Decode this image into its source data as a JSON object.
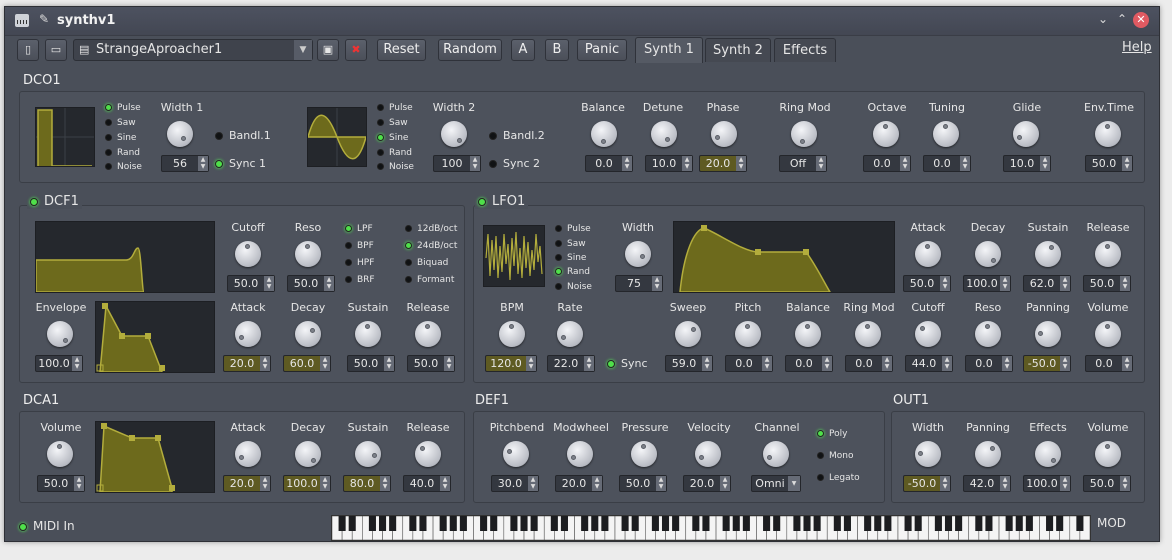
{
  "window": {
    "title": "synthv1",
    "minimize": "⌄",
    "maximize": "⌃",
    "close": "✕"
  },
  "toolbar": {
    "preset": "StrangeAproacher1",
    "reset": "Reset",
    "random": "Random",
    "a": "A",
    "b": "B",
    "panic": "Panic",
    "help": "Help"
  },
  "tabs": [
    {
      "label": "Synth 1",
      "active": true
    },
    {
      "label": "Synth 2",
      "active": false
    },
    {
      "label": "Effects",
      "active": false
    }
  ],
  "dco1": {
    "title": "DCO1",
    "shape1": {
      "options": [
        "Pulse",
        "Saw",
        "Sine",
        "Rand",
        "Noise"
      ],
      "selected": "Pulse"
    },
    "width1": {
      "label": "Width 1",
      "value": "56"
    },
    "bandl1": "Bandl.1",
    "sync1": "Sync 1",
    "shape2": {
      "options": [
        "Pulse",
        "Saw",
        "Sine",
        "Rand",
        "Noise"
      ],
      "selected": "Sine"
    },
    "width2": {
      "label": "Width 2",
      "value": "100"
    },
    "bandl2": "Bandl.2",
    "sync2": "Sync 2",
    "knobs": [
      {
        "label": "Balance",
        "value": "0.0"
      },
      {
        "label": "Detune",
        "value": "10.0"
      },
      {
        "label": "Phase",
        "value": "20.0"
      },
      {
        "label": "Ring Mod",
        "value": "Off"
      },
      {
        "label": "Octave",
        "value": "0.0"
      },
      {
        "label": "Tuning",
        "value": "0.0"
      },
      {
        "label": "Glide",
        "value": "10.0"
      },
      {
        "label": "Env.Time",
        "value": "50.0"
      }
    ]
  },
  "dcf1": {
    "title": "DCF1",
    "cutoff": {
      "label": "Cutoff",
      "value": "50.0"
    },
    "reso": {
      "label": "Reso",
      "value": "50.0"
    },
    "types": [
      "LPF",
      "BPF",
      "HPF",
      "BRF"
    ],
    "type_selected": "LPF",
    "slopes": [
      "12dB/oct",
      "24dB/oct",
      "Biquad",
      "Formant"
    ],
    "slope_selected": "24dB/oct",
    "envelope": {
      "label": "Envelope",
      "value": "100.0"
    },
    "adsr": [
      {
        "label": "Attack",
        "value": "20.0"
      },
      {
        "label": "Decay",
        "value": "60.0"
      },
      {
        "label": "Sustain",
        "value": "50.0"
      },
      {
        "label": "Release",
        "value": "50.0"
      }
    ]
  },
  "lfo1": {
    "title": "LFO1",
    "shapes": [
      "Pulse",
      "Saw",
      "Sine",
      "Rand",
      "Noise"
    ],
    "shape_selected": "Rand",
    "width": {
      "label": "Width",
      "value": "75"
    },
    "adsr": [
      {
        "label": "Attack",
        "value": "50.0"
      },
      {
        "label": "Decay",
        "value": "100.0"
      },
      {
        "label": "Sustain",
        "value": "62.0"
      },
      {
        "label": "Release",
        "value": "50.0"
      }
    ],
    "bpm": {
      "label": "BPM",
      "value": "120.0"
    },
    "rate": {
      "label": "Rate",
      "value": "22.0"
    },
    "sync": "Sync",
    "mods": [
      {
        "label": "Sweep",
        "value": "59.0"
      },
      {
        "label": "Pitch",
        "value": "0.0"
      },
      {
        "label": "Balance",
        "value": "0.0"
      },
      {
        "label": "Ring Mod",
        "value": "0.0"
      },
      {
        "label": "Cutoff",
        "value": "44.0"
      },
      {
        "label": "Reso",
        "value": "0.0"
      },
      {
        "label": "Panning",
        "value": "-50.0"
      },
      {
        "label": "Volume",
        "value": "0.0"
      }
    ]
  },
  "dca1": {
    "title": "DCA1",
    "volume": {
      "label": "Volume",
      "value": "50.0"
    },
    "adsr": [
      {
        "label": "Attack",
        "value": "20.0"
      },
      {
        "label": "Decay",
        "value": "100.0"
      },
      {
        "label": "Sustain",
        "value": "80.0"
      },
      {
        "label": "Release",
        "value": "40.0"
      }
    ]
  },
  "def1": {
    "title": "DEF1",
    "knobs": [
      {
        "label": "Pitchbend",
        "value": "30.0"
      },
      {
        "label": "Modwheel",
        "value": "20.0"
      },
      {
        "label": "Pressure",
        "value": "50.0"
      },
      {
        "label": "Velocity",
        "value": "20.0"
      }
    ],
    "channel": {
      "label": "Channel",
      "value": "Omni"
    },
    "modes": [
      "Poly",
      "Mono",
      "Legato"
    ],
    "mode_selected": "Poly"
  },
  "out1": {
    "title": "OUT1",
    "knobs": [
      {
        "label": "Width",
        "value": "-50.0"
      },
      {
        "label": "Panning",
        "value": "42.0"
      },
      {
        "label": "Effects",
        "value": "100.0"
      },
      {
        "label": "Volume",
        "value": "50.0"
      }
    ]
  },
  "status": {
    "midi_in": "MIDI In",
    "mod": "MOD"
  },
  "colors": {
    "accent": "#4fe04a",
    "env_fill": "#6d6a1c",
    "env_stroke": "#b3ad3c",
    "highlight": "#5e5a22"
  }
}
